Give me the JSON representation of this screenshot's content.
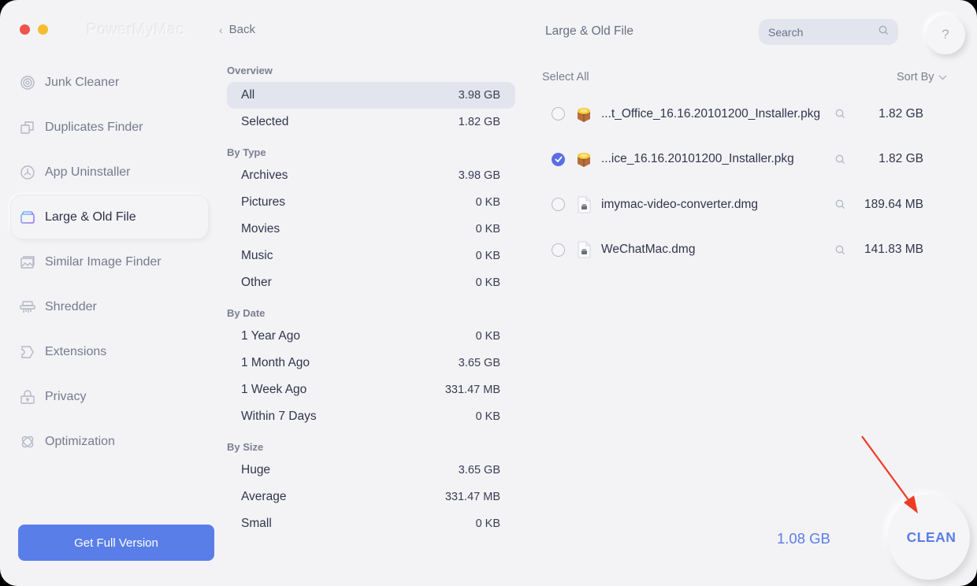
{
  "window": {
    "app_title": "PowerMyMac",
    "back_label": "Back"
  },
  "sidebar": {
    "items": [
      {
        "label": "Junk Cleaner",
        "icon": "junk-cleaner-icon",
        "active": false
      },
      {
        "label": "Duplicates Finder",
        "icon": "duplicates-icon",
        "active": false
      },
      {
        "label": "App Uninstaller",
        "icon": "app-uninstaller-icon",
        "active": false
      },
      {
        "label": "Large & Old File",
        "icon": "large-old-file-icon",
        "active": true
      },
      {
        "label": "Similar Image Finder",
        "icon": "similar-image-icon",
        "active": false
      },
      {
        "label": "Shredder",
        "icon": "shredder-icon",
        "active": false
      },
      {
        "label": "Extensions",
        "icon": "extensions-icon",
        "active": false
      },
      {
        "label": "Privacy",
        "icon": "privacy-lock-icon",
        "active": false
      },
      {
        "label": "Optimization",
        "icon": "optimization-icon",
        "active": false
      }
    ],
    "get_full_version": "Get Full Version"
  },
  "categories": {
    "overview": {
      "heading": "Overview",
      "rows": [
        {
          "label": "All",
          "value": "3.98 GB",
          "active": true
        },
        {
          "label": "Selected",
          "value": "1.82 GB",
          "active": false
        }
      ]
    },
    "by_type": {
      "heading": "By Type",
      "rows": [
        {
          "label": "Archives",
          "value": "3.98 GB"
        },
        {
          "label": "Pictures",
          "value": "0 KB"
        },
        {
          "label": "Movies",
          "value": "0 KB"
        },
        {
          "label": "Music",
          "value": "0 KB"
        },
        {
          "label": "Other",
          "value": "0 KB"
        }
      ]
    },
    "by_date": {
      "heading": "By Date",
      "rows": [
        {
          "label": "1 Year Ago",
          "value": "0 KB"
        },
        {
          "label": "1 Month Ago",
          "value": "3.65 GB"
        },
        {
          "label": "1 Week Ago",
          "value": "331.47 MB"
        },
        {
          "label": "Within 7 Days",
          "value": "0 KB"
        }
      ]
    },
    "by_size": {
      "heading": "By Size",
      "rows": [
        {
          "label": "Huge",
          "value": "3.65 GB"
        },
        {
          "label": "Average",
          "value": "331.47 MB"
        },
        {
          "label": "Small",
          "value": "0 KB"
        }
      ]
    }
  },
  "right_panel": {
    "title": "Large & Old File",
    "search_placeholder": "Search",
    "help_label": "?",
    "select_all": "Select All",
    "sort_by": "Sort By",
    "files": [
      {
        "name": "...t_Office_16.16.20101200_Installer.pkg",
        "size": "1.82 GB",
        "checked": false,
        "type": "pkg"
      },
      {
        "name": "...ice_16.16.20101200_Installer.pkg",
        "size": "1.82 GB",
        "checked": true,
        "type": "pkg"
      },
      {
        "name": "imymac-video-converter.dmg",
        "size": "189.64 MB",
        "checked": false,
        "type": "dmg"
      },
      {
        "name": "WeChatMac.dmg",
        "size": "141.83 MB",
        "checked": false,
        "type": "dmg"
      }
    ],
    "total_size": "1.08 GB",
    "clean_label": "CLEAN"
  },
  "colors": {
    "accent": "#5a7ee8",
    "checkbox": "#5a6fe6",
    "annotation_arrow": "#ee3b24"
  }
}
